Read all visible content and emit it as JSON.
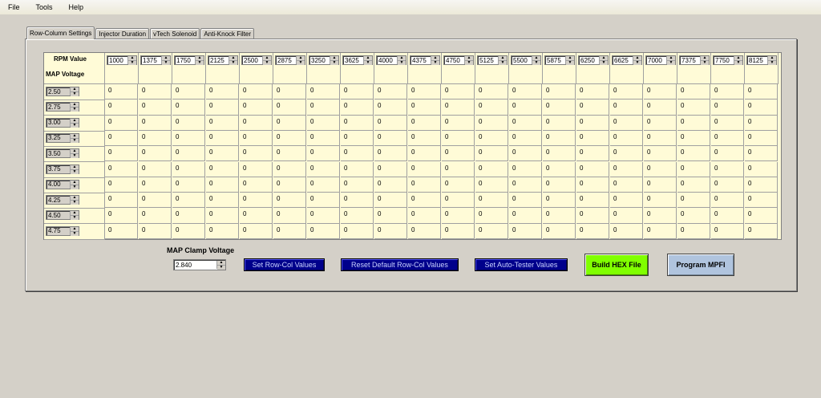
{
  "menu": [
    "File",
    "Tools",
    "Help"
  ],
  "tabs": [
    "Row-Column Settings",
    "Injector Duration",
    "vTech Solenoid",
    "Anti-Knock Filter"
  ],
  "active_tab": 0,
  "grid": {
    "rpm_label": "RPM Value",
    "map_label": "MAP Voltage",
    "rpm_values": [
      "1000",
      "1375",
      "1750",
      "2125",
      "2500",
      "2875",
      "3250",
      "3625",
      "4000",
      "4375",
      "4750",
      "5125",
      "5500",
      "5875",
      "6250",
      "6625",
      "7000",
      "7375",
      "7750",
      "8125"
    ],
    "map_values": [
      "2.50",
      "2.75",
      "3.00",
      "3.25",
      "3.50",
      "3.75",
      "4.00",
      "4.25",
      "4.50",
      "4.75"
    ],
    "cell_value": "0"
  },
  "clamp": {
    "label": "MAP Clamp Voltage",
    "value": "2.840"
  },
  "buttons": {
    "set_row_col": "Set Row-Col Values",
    "reset_default": "Reset Default Row-Col Values",
    "set_auto_tester": "Set Auto-Tester Values",
    "build_hex": "Build HEX File",
    "program_mpfi": "Program MPFI"
  },
  "colors": {
    "grid_bg": "#fffbd7",
    "blue_button": "#00008b",
    "green_button": "#80ff00",
    "gray_button": "#b0c4de"
  }
}
